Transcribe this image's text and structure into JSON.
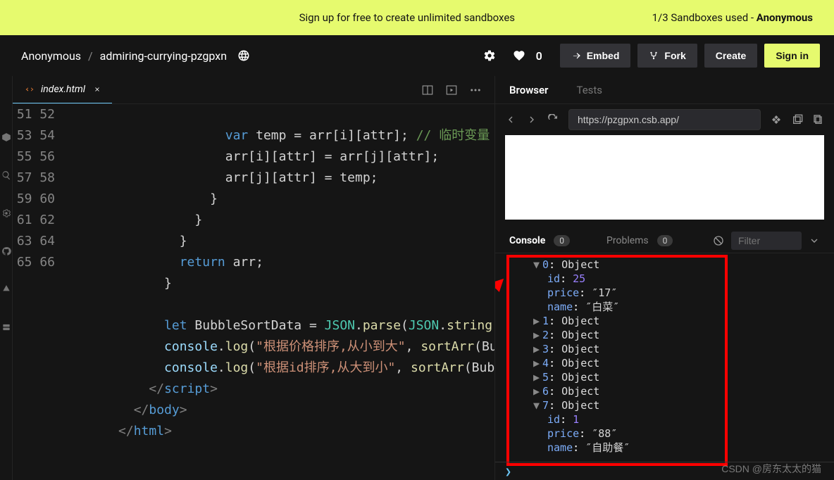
{
  "banner": {
    "signup_text": "Sign up for free to create unlimited sandboxes",
    "usage_prefix": "1/3 Sandboxes used - ",
    "usage_user": "Anonymous"
  },
  "header": {
    "user": "Anonymous",
    "project": "admiring-currying-pzgpxn",
    "like_count": "0",
    "embed": "Embed",
    "fork": "Fork",
    "create": "Create",
    "signin": "Sign in"
  },
  "tabs": {
    "file": "index.html"
  },
  "editor": {
    "line_start": 51,
    "line_end": 66,
    "code_51_a": "var",
    "code_51_b": " temp = arr[i][attr]; ",
    "code_51_c": "// 临时变量",
    "code_52": "arr[i][attr] = arr[j][attr];",
    "code_53": "arr[j][attr] = temp;",
    "code_54": "}",
    "code_55": "}",
    "code_56": "}",
    "code_57_a": "return",
    "code_57_b": " arr;",
    "code_58": "}",
    "code_60_a": "let",
    "code_60_b": " BubbleSortData = ",
    "code_60_c": "JSON",
    "code_60_d": ".",
    "code_60_e": "parse",
    "code_60_f": "(",
    "code_60_g": "JSON",
    "code_60_h": ".",
    "code_60_i": "string",
    "code_61_a": "console",
    "code_61_b": ".",
    "code_61_c": "log",
    "code_61_d": "(",
    "code_61_e": "\"根据价格排序,从小到大\"",
    "code_61_f": ", ",
    "code_61_g": "sortArr",
    "code_61_h": "(Bub",
    "code_62_a": "console",
    "code_62_b": ".",
    "code_62_c": "log",
    "code_62_d": "(",
    "code_62_e": "\"根据id排序,从大到小\"",
    "code_62_f": ", ",
    "code_62_g": "sortArr",
    "code_62_h": "(Bubb",
    "code_63": "script",
    "code_64": "body",
    "code_65": "html"
  },
  "browser": {
    "tab_browser": "Browser",
    "tab_tests": "Tests",
    "url": "https://pzgpxn.csb.app/"
  },
  "console": {
    "tab_console": "Console",
    "tab_problems": "Problems",
    "console_count": "0",
    "problems_count": "0",
    "filter_placeholder": "Filter",
    "prompt": "❯",
    "entries": [
      {
        "index": "0",
        "expanded": true,
        "props": {
          "id": "25",
          "price": "17",
          "name": "白菜"
        }
      },
      {
        "index": "1",
        "expanded": false
      },
      {
        "index": "2",
        "expanded": false
      },
      {
        "index": "3",
        "expanded": false
      },
      {
        "index": "4",
        "expanded": false
      },
      {
        "index": "5",
        "expanded": false
      },
      {
        "index": "6",
        "expanded": false
      },
      {
        "index": "7",
        "expanded": true,
        "props": {
          "id": "1",
          "price": "88",
          "name": "自助餐"
        }
      }
    ],
    "obj_label": "Object"
  },
  "watermark": "CSDN @房东太太的猫"
}
